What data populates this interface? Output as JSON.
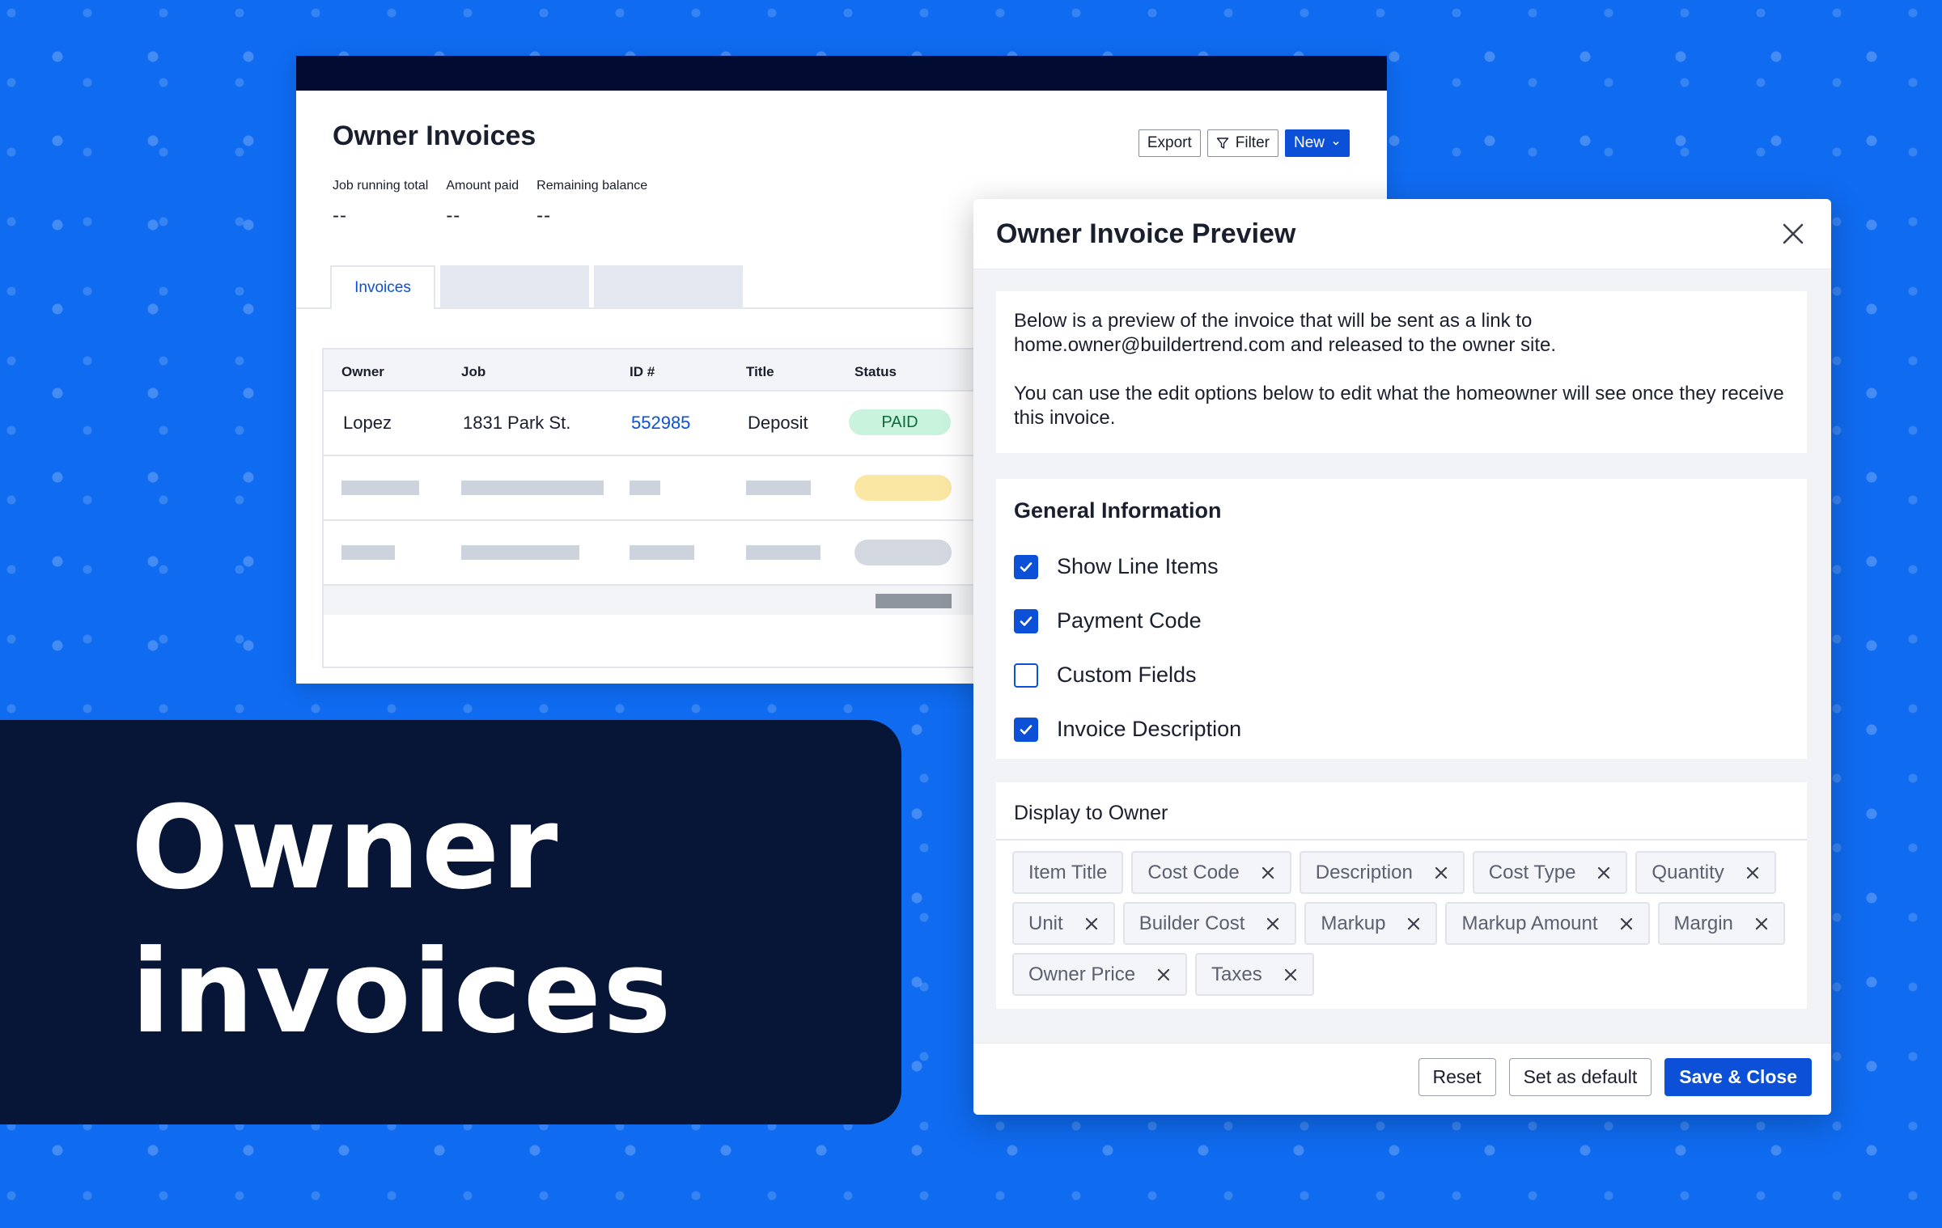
{
  "app": {
    "page_title": "Owner Invoices",
    "toolbar": {
      "export": "Export",
      "filter": "Filter",
      "new": "New"
    },
    "stats": [
      {
        "label": "Job running total",
        "value": "--"
      },
      {
        "label": "Amount paid",
        "value": "--"
      },
      {
        "label": "Remaining balance",
        "value": "--"
      }
    ],
    "tabs": {
      "active": "Invoices"
    },
    "table": {
      "columns": [
        "Owner",
        "Job",
        "ID #",
        "Title",
        "Status"
      ],
      "rows": [
        {
          "owner": "Lopez",
          "job": "1831 Park St.",
          "id": "552985",
          "title": "Deposit",
          "status": "PAID"
        }
      ]
    }
  },
  "promo": {
    "line1": "Owner",
    "line2": "invoices"
  },
  "modal": {
    "title": "Owner Invoice Preview",
    "intro_p1": "Below is a preview of the invoice that will be sent as a link to home.owner@buildertrend.com and released to the owner site.",
    "intro_p2": "You can use the edit options below to edit what the homeowner will see once they receive this invoice.",
    "general": {
      "title": "General Information",
      "options": [
        {
          "label": "Show Line Items",
          "checked": true
        },
        {
          "label": "Payment Code",
          "checked": true
        },
        {
          "label": "Custom Fields",
          "checked": false
        },
        {
          "label": "Invoice Description",
          "checked": true
        }
      ]
    },
    "display": {
      "title": "Display to Owner",
      "chips": [
        {
          "label": "Item Title",
          "removable": false
        },
        {
          "label": "Cost Code",
          "removable": true
        },
        {
          "label": "Description",
          "removable": true
        },
        {
          "label": "Cost Type",
          "removable": true
        },
        {
          "label": "Quantity",
          "removable": true
        },
        {
          "label": "Unit",
          "removable": true
        },
        {
          "label": "Builder Cost",
          "removable": true
        },
        {
          "label": "Markup",
          "removable": true
        },
        {
          "label": "Markup Amount",
          "removable": true
        },
        {
          "label": "Margin",
          "removable": true
        },
        {
          "label": "Owner Price",
          "removable": true
        },
        {
          "label": "Taxes",
          "removable": true
        }
      ]
    },
    "footer": {
      "reset": "Reset",
      "set_default": "Set as default",
      "save_close": "Save & Close"
    }
  },
  "colors": {
    "background": "#0f6bf0",
    "primary": "#0b50d6",
    "navy": "#071636",
    "paid_bg": "#c9f3dc",
    "pending_bg": "#fbe7a4"
  }
}
